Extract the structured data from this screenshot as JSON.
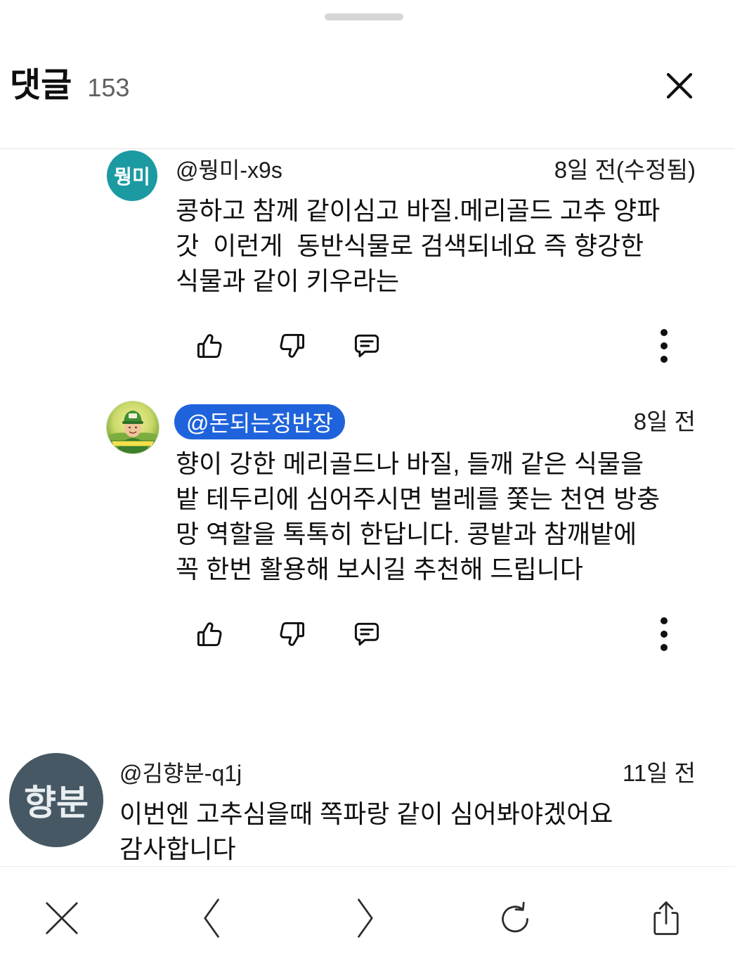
{
  "sheet": {
    "title": "댓글",
    "count": "153",
    "close_icon": "close-icon"
  },
  "comment_action_icons": [
    "thumbs-up-icon",
    "thumbs-down-icon",
    "reply-icon",
    "more-vert-icon"
  ],
  "comments": [
    {
      "avatar_text": "뭥미",
      "avatar_color": "#1b9aa2",
      "handle": "@뭥미-x9s",
      "time": "8일 전(수정됨)",
      "body": "콩하고 참께 같이심고 바질.메리골드 고추 양파\n갓  이런게  동반식물로 검색되네요 즉 향강한\n식물과 같이 키우라는"
    },
    {
      "avatar_icon": "channel-avatar-illustration",
      "handle": "@돈되는정반장",
      "handle_badge_color": "#1f63dc",
      "time": "8일 전",
      "body": "향이 강한 메리골드나 바질, 들깨 같은 식물을\n밭 테두리에 심어주시면 벌레를 쫓는 천연 방충\n망 역할을 톡톡히 한답니다. 콩밭과 참깨밭에\n꼭 한번 활용해 보시길 추천해 드립니다"
    },
    {
      "avatar_text": "향분",
      "avatar_color": "#465863",
      "handle": "@김향분-q1j",
      "time": "11일 전",
      "body": "이번엔 고추심을때 쪽파랑 같이 심어봐야겠어요\n감사합니다"
    }
  ],
  "browser_toolbar": {
    "icons": [
      "close-icon",
      "back-icon",
      "forward-icon",
      "reload-icon",
      "share-icon"
    ]
  }
}
